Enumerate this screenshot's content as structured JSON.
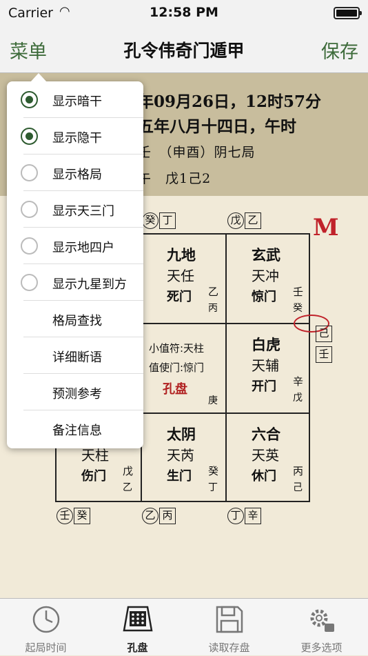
{
  "status": {
    "carrier": "Carrier",
    "time": "12:58 PM"
  },
  "nav": {
    "menu": "菜单",
    "title": "孔令伟奇门遁甲",
    "save": "保存"
  },
  "header": {
    "line1": "年09月26日，12时57分",
    "line2": "五年八月十四日，午时",
    "line3": "壬　（申酉）阴七局",
    "line4": "午　戊1己2"
  },
  "menu": {
    "items": [
      {
        "label": "显示暗干",
        "radio": true,
        "checked": true
      },
      {
        "label": "显示隐干",
        "radio": true,
        "checked": true
      },
      {
        "label": "显示格局",
        "radio": true,
        "checked": false
      },
      {
        "label": "显示天三门",
        "radio": true,
        "checked": false
      },
      {
        "label": "显示地四户",
        "radio": true,
        "checked": false
      },
      {
        "label": "显示九星到方",
        "radio": true,
        "checked": false
      },
      {
        "label": "格局查找",
        "radio": false
      },
      {
        "label": "详细断语",
        "radio": false
      },
      {
        "label": "预测参考",
        "radio": false
      },
      {
        "label": "备注信息",
        "radio": false
      }
    ]
  },
  "board": {
    "logo": "M",
    "top_markers": {
      "left": [
        "癸",
        "丁"
      ],
      "right": [
        "戊",
        "乙"
      ]
    },
    "right_markers": [
      "己",
      "壬"
    ],
    "bottom_markers": {
      "left": [
        "壬",
        "癸"
      ],
      "mid": [
        "乙",
        "丙"
      ],
      "right": [
        "丁",
        "辛"
      ]
    },
    "cells": {
      "top_mid": {
        "god": "九地",
        "star": "天任",
        "door": "死门",
        "s1": "乙",
        "s2": "丙"
      },
      "top_right": {
        "god": "玄武",
        "star": "天冲",
        "door": "惊门",
        "s1": "壬",
        "s2": "癸"
      },
      "center": {
        "l1": "小值符:天柱",
        "l2": "值使门:惊门",
        "l3": "孔盘",
        "l4": "庚"
      },
      "mid_right": {
        "god": "白虎",
        "star": "天辅",
        "door": "开门",
        "s1": "辛",
        "s2": "戊"
      },
      "bot_left": {
        "star": "天柱",
        "door": "伤门",
        "s1": "戊",
        "s2": "乙"
      },
      "bot_mid": {
        "god": "太阴",
        "star": "天芮",
        "door": "生门",
        "s1": "癸",
        "s2": "丁"
      },
      "bot_right": {
        "god": "六合",
        "star": "天英",
        "door": "休门",
        "s1": "丙",
        "s2": "己"
      }
    }
  },
  "tabs": [
    {
      "label": "起局时间",
      "icon": "clock-icon"
    },
    {
      "label": "孔盘",
      "icon": "grid-board-icon"
    },
    {
      "label": "读取存盘",
      "icon": "floppy-disk-icon"
    },
    {
      "label": "更多选项",
      "icon": "gears-icon"
    }
  ],
  "colors": {
    "accent": "#3d6b3a",
    "red": "#c0222a",
    "header_bg": "#c8bd9d"
  }
}
